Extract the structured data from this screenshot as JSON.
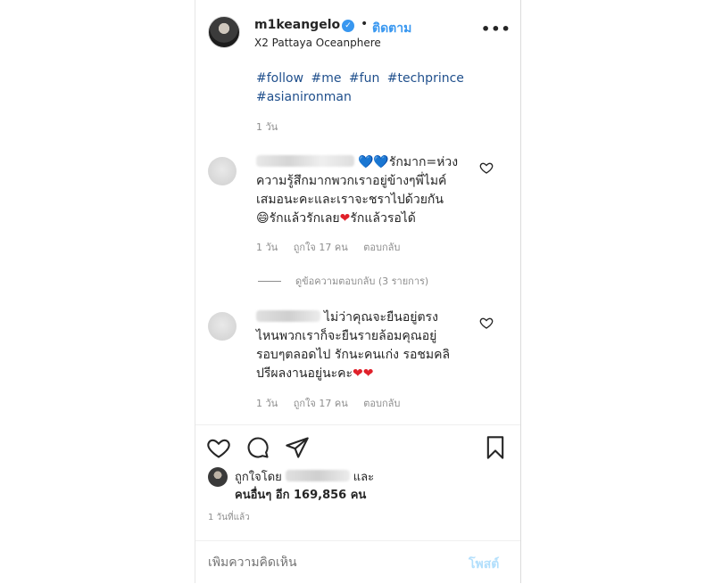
{
  "header": {
    "username": "m1keangelo",
    "separator": "•",
    "follow_label": "ติดตาม",
    "location": "X2 Pattaya Oceanphere",
    "more_label": "•••"
  },
  "caption": {
    "hashtags": [
      "#follow",
      "#me",
      "#fun",
      "#techprince",
      "#asianironman"
    ],
    "time": "1 วัน"
  },
  "comments": [
    {
      "text_line1_hearts": "💙💙",
      "text_line1": "รักมาก=ห่วง",
      "text_line2": "ความรู้สึกมากพวกเราอยู่ข้างๆพี่ไมค์",
      "text_line3": "เสมอนะคะและเราจะชราไปด้วยกัน",
      "text_line4_emoji": "😄",
      "text_line4a": "รักแล้วรักเลย",
      "text_line4_heart": "❤",
      "text_line4b": "รักแล้วรอได้",
      "time": "1 วัน",
      "likes": "ถูกใจ 17 คน",
      "reply": "ตอบกลับ",
      "view_replies": "ดูข้อความตอบกลับ (3 รายการ)"
    },
    {
      "text_line1": "ไม่ว่าคุณจะยืนอยู่ตรง",
      "text_line2": "ไหนพวกเราก็จะยืนรายล้อมคุณอยู่",
      "text_line3": "รอบๆตลอดไป รักนะคนเก่ง รอชมคลิ",
      "text_line4": "ปรีผลงานอยู่นะคะ",
      "text_line4_hearts": "❤❤",
      "time": "1 วัน",
      "likes": "ถูกใจ 17 คน",
      "reply": "ตอบกลับ"
    }
  ],
  "likes": {
    "prefix": "ถูกใจโดย",
    "suffix": "และ",
    "others": "คนอื่นๆ อีก 169,856 คน"
  },
  "posted_ago": "1 วันที่แล้ว",
  "comment_input": {
    "placeholder": "เพิ่มความคิดเห็น",
    "post_label": "โพสต์"
  },
  "colors": {
    "link": "#3897f0",
    "hashtag": "#1f4f8c",
    "muted": "#8e8e8e",
    "post_disabled": "#b2dffc"
  }
}
